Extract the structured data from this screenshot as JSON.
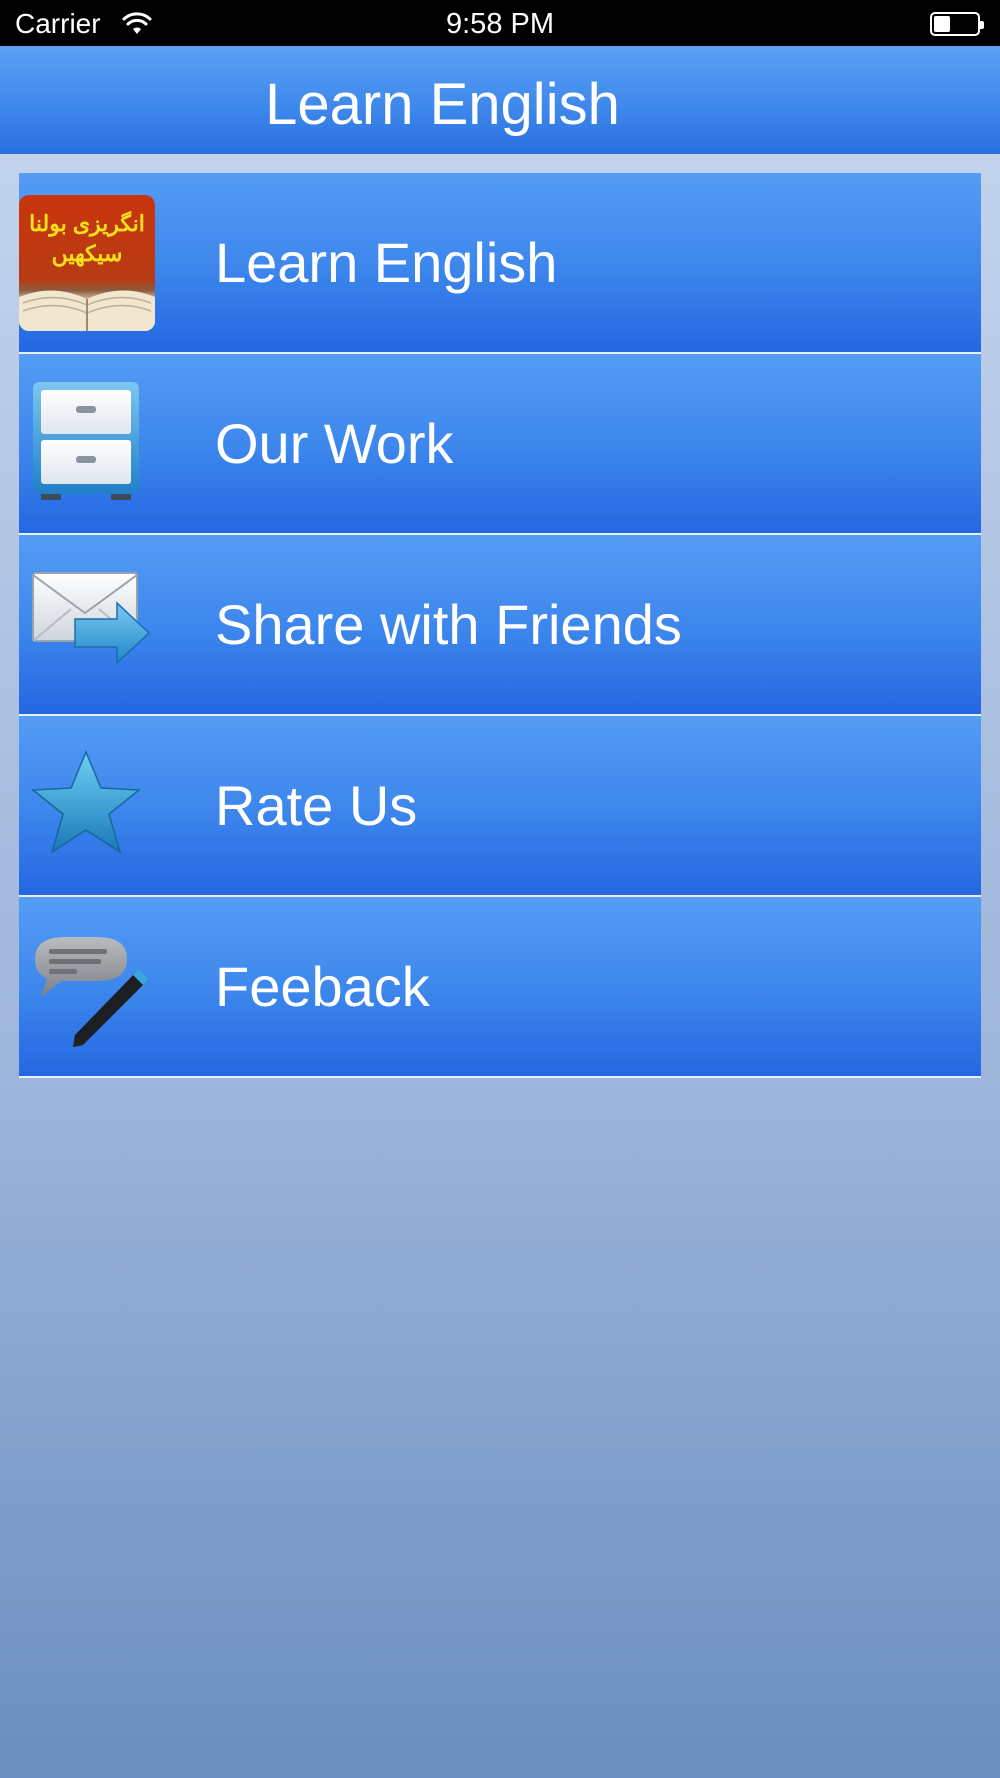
{
  "status_bar": {
    "carrier": "Carrier",
    "time": "9:58 PM",
    "wifi_icon": "wifi-icon",
    "battery_icon": "battery-icon",
    "battery_level": 0.35
  },
  "nav": {
    "title": "Learn English"
  },
  "menu": {
    "items": [
      {
        "label": "Learn English",
        "icon": "urdu-book-icon",
        "icon_text": [
          "انگریزی بولنا",
          "سیکھیں"
        ]
      },
      {
        "label": "Our Work",
        "icon": "file-cabinet-icon"
      },
      {
        "label": "Share with Friends",
        "icon": "mail-forward-icon"
      },
      {
        "label": "Rate Us",
        "icon": "star-icon"
      },
      {
        "label": "Feeback",
        "icon": "feedback-chat-pencil-icon"
      }
    ]
  },
  "colors": {
    "nav_top": "#5aa0f4",
    "nav_bottom": "#2a6fe0",
    "item_top": "#559cf5",
    "item_bottom": "#2467e2",
    "background_bottom": "#6b8fc0"
  }
}
